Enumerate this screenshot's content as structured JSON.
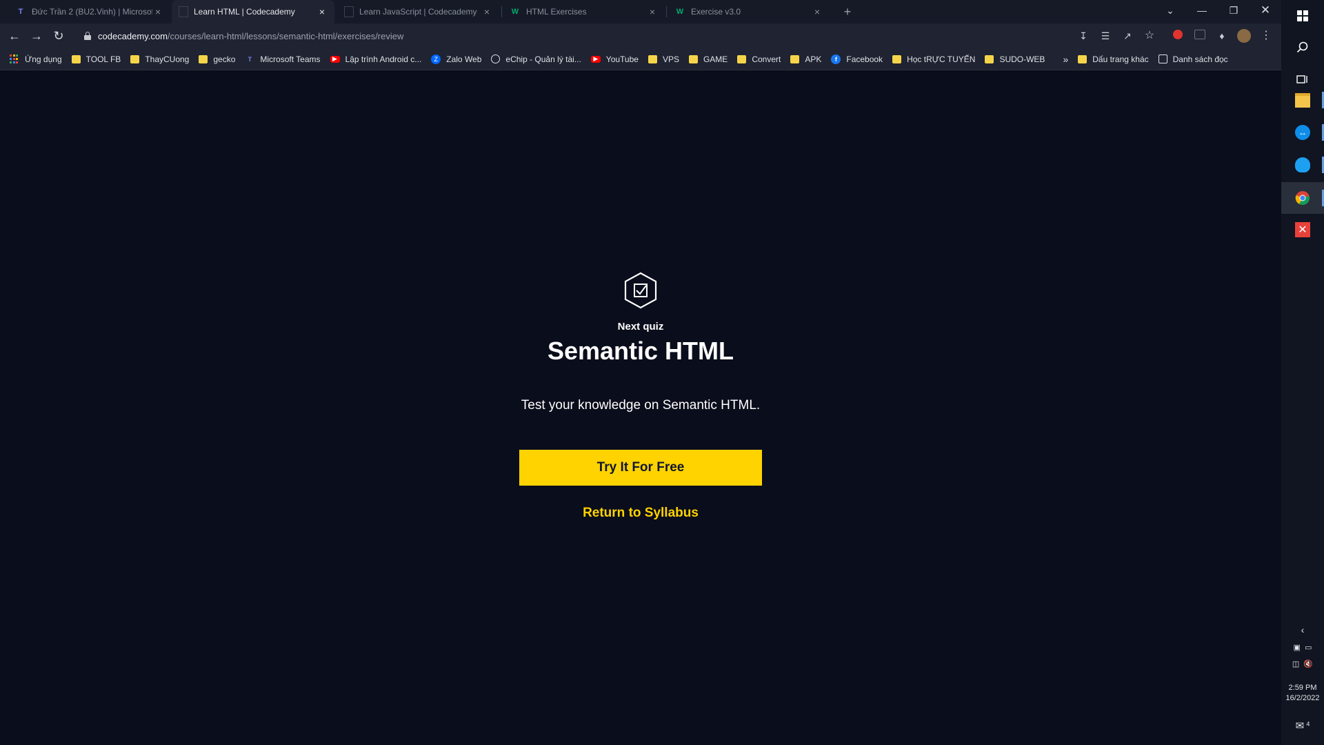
{
  "browser": {
    "tabs": [
      {
        "title": "Đức Trần 2 (BU2.Vinh) | Microsof",
        "icon": "teams-icon",
        "active": false
      },
      {
        "title": "Learn HTML | Codecademy",
        "icon": "codecademy-icon",
        "active": true
      },
      {
        "title": "Learn JavaScript | Codecademy",
        "icon": "codecademy-icon",
        "active": false
      },
      {
        "title": "HTML Exercises",
        "icon": "w3schools-icon",
        "active": false
      },
      {
        "title": "Exercise v3.0",
        "icon": "w3schools-icon",
        "active": false
      }
    ],
    "url_host": "codecademy.com",
    "url_path": "/courses/learn-html/lessons/semantic-html/exercises/review",
    "bookmarks": [
      {
        "label": "Ứng dụng",
        "icon": "apps-icon"
      },
      {
        "label": "TOOL FB",
        "icon": "folder-icon"
      },
      {
        "label": "ThayCUong",
        "icon": "folder-icon"
      },
      {
        "label": "gecko",
        "icon": "folder-icon"
      },
      {
        "label": "Microsoft Teams",
        "icon": "teams-icon"
      },
      {
        "label": "Lập trình Android c...",
        "icon": "youtube-icon"
      },
      {
        "label": "Zalo Web",
        "icon": "zalo-icon"
      },
      {
        "label": "eChip - Quản lý tài...",
        "icon": "globe-icon"
      },
      {
        "label": "YouTube",
        "icon": "youtube-icon"
      },
      {
        "label": "VPS",
        "icon": "folder-icon"
      },
      {
        "label": "GAME",
        "icon": "folder-icon"
      },
      {
        "label": "Convert",
        "icon": "folder-icon"
      },
      {
        "label": "APK",
        "icon": "folder-icon"
      },
      {
        "label": "Facebook",
        "icon": "facebook-icon"
      },
      {
        "label": "Học tRỰC TUYẾN",
        "icon": "folder-icon"
      },
      {
        "label": "SUDO-WEB",
        "icon": "folder-icon"
      }
    ],
    "overflow_label": "»",
    "other_bookmarks": "Dấu trang khác",
    "reading_list": "Danh sách đọc"
  },
  "page": {
    "eyebrow": "Next quiz",
    "title": "Semantic HTML",
    "description": "Test your knowledge on Semantic HTML.",
    "cta_label": "Try It For Free",
    "link_label": "Return to Syllabus"
  },
  "taskbar": {
    "time": "2:59 PM",
    "date": "16/2/2022",
    "notification_count": "4"
  },
  "colors": {
    "page_background": "#0a0d1b",
    "accent": "#ffd300",
    "cta_text": "#10162f"
  }
}
